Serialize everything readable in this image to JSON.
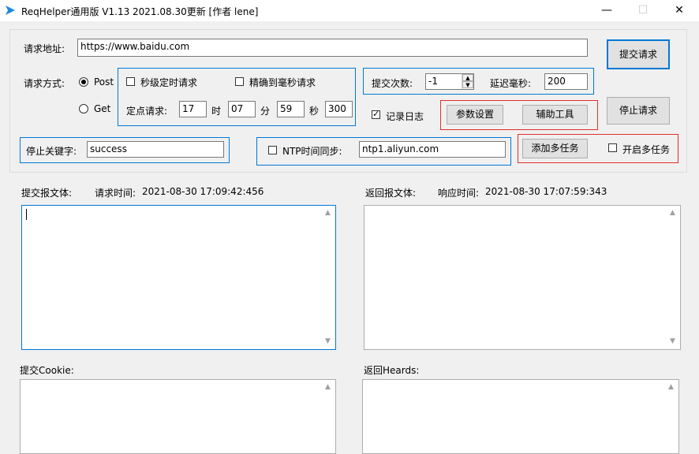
{
  "window": {
    "title": "ReqHelper通用版 V1.13  2021.08.30更新   [作者 lene]",
    "minimize": "—",
    "maximize": "☐",
    "close": "✕"
  },
  "request": {
    "url_label": "请求地址:",
    "url_value": "https://www.baidu.com",
    "method_label": "请求方式:",
    "method_post": "Post",
    "method_get": "Get",
    "method_selected": "Post"
  },
  "timer": {
    "second_timer_label": "秒级定时请求",
    "ms_precise_label": "精确到毫秒请求",
    "fixed_label": "定点请求:",
    "hour_value": "17",
    "hour_unit": "时",
    "minute_value": "07",
    "minute_unit": "分",
    "second_value": "59",
    "second_unit": "秒",
    "ms_value": "300"
  },
  "submit": {
    "count_label": "提交次数:",
    "count_value": "-1",
    "delay_label": "延迟毫秒:",
    "delay_value": "200",
    "log_label": "记录日志",
    "log_checked": true
  },
  "buttons": {
    "submit": "提交请求",
    "stop": "停止请求",
    "params": "参数设置",
    "tools": "辅助工具",
    "add_tasks": "添加多任务",
    "enable_multi": "开启多任务"
  },
  "keyword": {
    "label": "停止关键字:",
    "value": "success"
  },
  "ntp": {
    "label": "NTP时间同步:",
    "value": "ntp1.aliyun.com"
  },
  "panels": {
    "request_body_label": "提交报文体:",
    "request_time_label": "请求时间:",
    "request_time_value": "2021-08-30 17:09:42:456",
    "response_body_label": "返回报文体:",
    "response_time_label": "响应时间:",
    "response_time_value": "2021-08-30 17:07:59:343",
    "cookie_label": "提交Cookie:",
    "headers_label": "返回Heards:"
  },
  "colors": {
    "accent": "#0078d7",
    "highlight_border": "#e0302a",
    "window_bg": "#f0f0f0"
  }
}
